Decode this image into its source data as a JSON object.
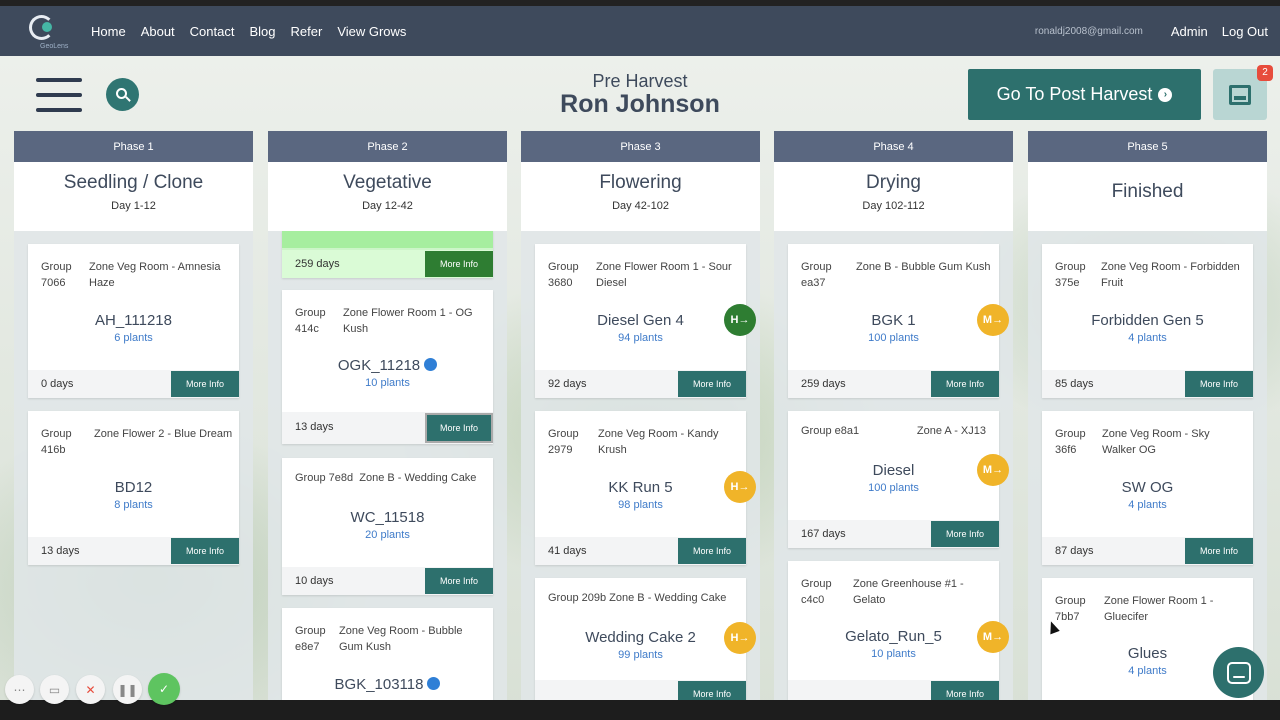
{
  "nav": {
    "logo_text": "GeoLens",
    "links": [
      "Home",
      "About",
      "Contact",
      "Blog",
      "Refer",
      "View Grows"
    ],
    "email": "ronaldj2008@gmail.com",
    "admin": "Admin",
    "logout": "Log Out"
  },
  "header": {
    "subtitle": "Pre Harvest",
    "name": "Ron Johnson",
    "go_button": "Go To Post Harvest",
    "badge_count": "2"
  },
  "colors": {
    "nav": "#3e4a5c",
    "accent": "#2d706d",
    "phase_header": "#5a6780",
    "plants_link": "#3f7bc9",
    "badge_green": "#2e7d32",
    "badge_orange": "#f0b429"
  },
  "phases": [
    {
      "phase": "Phase 1",
      "name": "Seedling / Clone",
      "days": "Day 1-12",
      "cards": [
        {
          "group": "Group 7066",
          "zone": "Zone Veg Room - Amnesia Haze",
          "name": "AH_111218",
          "plants": "6 plants",
          "age": "0 days",
          "more": "More Info"
        },
        {
          "group": "Group 416b",
          "zone": "Zone Flower 2 - Blue Dream",
          "name": "BD12",
          "plants": "8 plants",
          "age": "13 days",
          "more": "More Info"
        }
      ]
    },
    {
      "phase": "Phase 2",
      "name": "Vegetative",
      "days": "Day 12-42",
      "top_strip": {
        "age": "259 days",
        "more": "More Info"
      },
      "cards": [
        {
          "group": "Group 414c",
          "zone": "Zone Flower Room 1 - OG Kush",
          "name": "OGK_11218",
          "plants": "10 plants",
          "age": "13 days",
          "more": "More Info"
        },
        {
          "group": "Group 7e8d",
          "zone": "Zone B - Wedding Cake",
          "name": "WC_11518",
          "plants": "20 plants",
          "age": "10 days",
          "more": "More Info"
        },
        {
          "group": "Group e8e7",
          "zone": "Zone Veg Room - Bubble Gum Kush",
          "name": "BGK_103118",
          "plants": "",
          "age": "",
          "more": ""
        }
      ]
    },
    {
      "phase": "Phase 3",
      "name": "Flowering",
      "days": "Day 42-102",
      "cards": [
        {
          "group": "Group 3680",
          "zone": "Zone Flower Room 1 - Sour Diesel",
          "name": "Diesel Gen 4",
          "plants": "94 plants",
          "age": "92 days",
          "more": "More Info",
          "badge": "H→",
          "badge_kind": "green"
        },
        {
          "group": "Group 2979",
          "zone": "Zone Veg Room - Kandy Krush",
          "name": "KK Run 5",
          "plants": "98 plants",
          "age": "41 days",
          "more": "More Info",
          "badge": "H→",
          "badge_kind": "orange"
        },
        {
          "group": "Group 209b",
          "zone": "Zone B - Wedding Cake",
          "name": "Wedding Cake 2",
          "plants": "99 plants",
          "age": "",
          "more": "More Info",
          "badge": "H→",
          "badge_kind": "orange"
        }
      ]
    },
    {
      "phase": "Phase 4",
      "name": "Drying",
      "days": "Day 102-112",
      "cards": [
        {
          "group": "Group ea37",
          "zone": "Zone B - Bubble Gum Kush",
          "name": "BGK 1",
          "plants": "100 plants",
          "age": "259 days",
          "more": "More Info",
          "badge": "M→",
          "badge_kind": "orange"
        },
        {
          "group": "Group e8a1",
          "zone": "Zone A - XJ13",
          "name": "Diesel",
          "plants": "100 plants",
          "age": "167 days",
          "more": "More Info",
          "badge": "M→",
          "badge_kind": "orange"
        },
        {
          "group": "Group c4c0",
          "zone": "Zone Greenhouse #1 - Gelato",
          "name": "Gelato_Run_5",
          "plants": "10 plants",
          "age": "",
          "more": "More Info",
          "badge": "M→",
          "badge_kind": "orange"
        }
      ]
    },
    {
      "phase": "Phase 5",
      "name": "Finished",
      "days": "",
      "cards": [
        {
          "group": "Group 375e",
          "zone": "Zone Veg Room - Forbidden Fruit",
          "name": "Forbidden Gen 5",
          "plants": "4 plants",
          "age": "85 days",
          "more": "More Info"
        },
        {
          "group": "Group 36f6",
          "zone": "Zone Veg Room - Sky Walker OG",
          "name": "SW OG",
          "plants": "4 plants",
          "age": "87 days",
          "more": "More Info"
        },
        {
          "group": "Group 7bb7",
          "zone": "Zone Flower Room 1 - Gluecifer",
          "name": "Glues",
          "plants": "4 plants",
          "age": "",
          "more": ""
        }
      ]
    }
  ]
}
